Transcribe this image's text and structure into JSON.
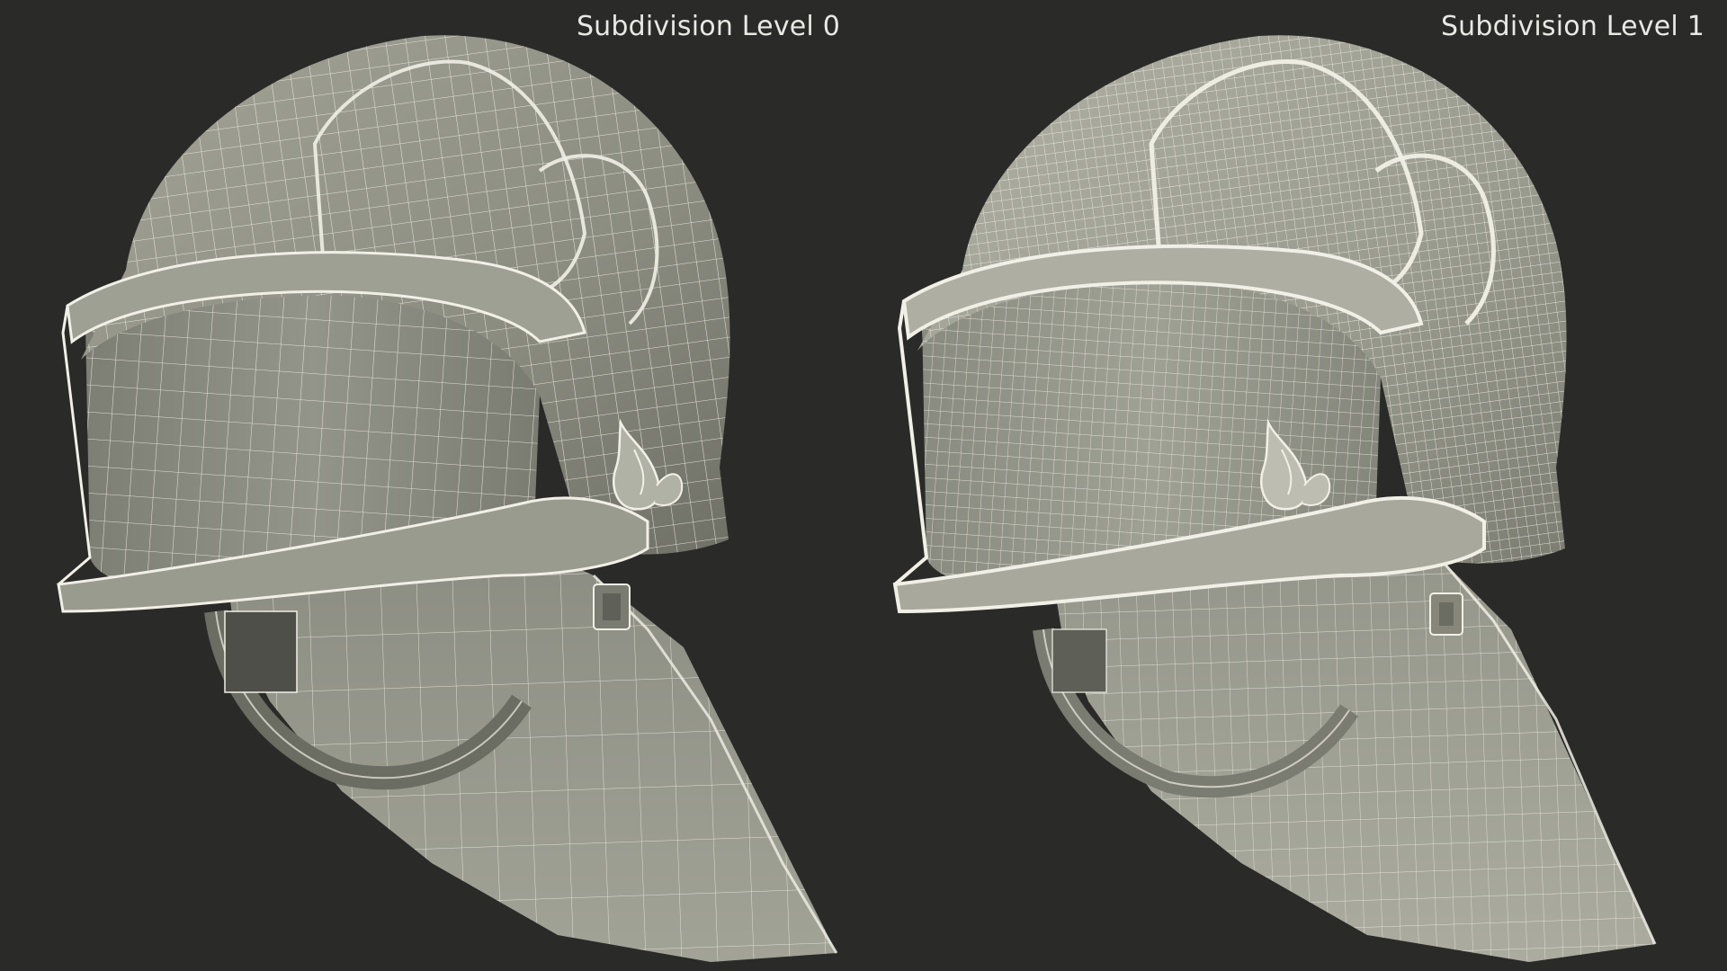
{
  "render": {
    "background": "#2a2a29",
    "surface_color": "#8e8f84",
    "wire_color": "#f1f0e6"
  },
  "panels": [
    {
      "label": "Subdivision Level 0",
      "object": "firefighter helmet with visor and neck curtain",
      "wire_density": 1
    },
    {
      "label": "Subdivision Level 1",
      "object": "firefighter helmet with visor and neck curtain",
      "wire_density": 2
    }
  ]
}
